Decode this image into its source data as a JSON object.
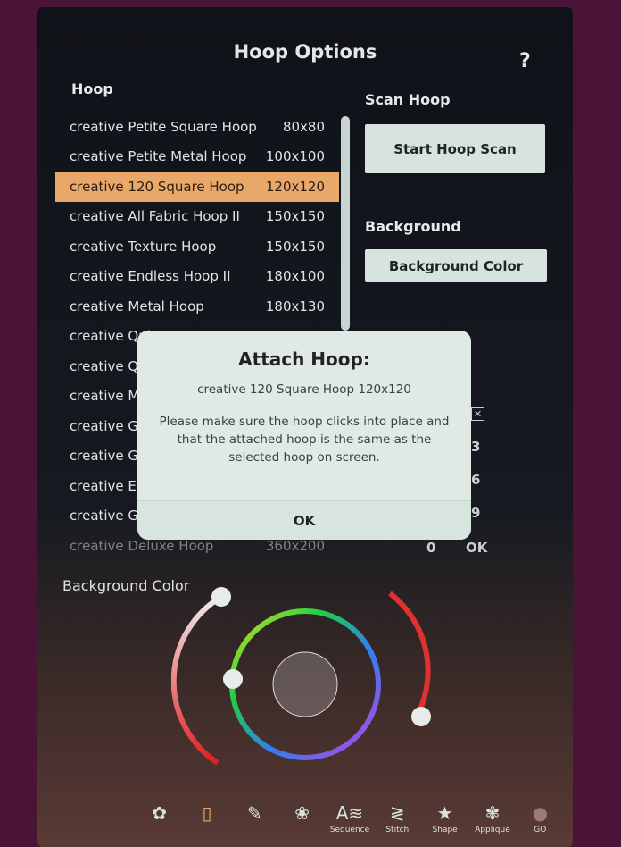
{
  "title": "Hoop Options",
  "help_label": "?",
  "hoop_section": {
    "label": "Hoop",
    "items": [
      {
        "name": "creative Petite Square Hoop",
        "size": "80x80"
      },
      {
        "name": "creative Petite Metal Hoop",
        "size": "100x100"
      },
      {
        "name": "creative 120 Square Hoop",
        "size": "120x120",
        "selected": true
      },
      {
        "name": "creative All Fabric Hoop II",
        "size": "150x150"
      },
      {
        "name": "creative Texture Hoop",
        "size": "150x150"
      },
      {
        "name": "creative Endless Hoop II",
        "size": "180x100"
      },
      {
        "name": "creative Metal Hoop",
        "size": "180x130"
      },
      {
        "name": "creative Qui",
        "size": ""
      },
      {
        "name": "creative Qu",
        "size": ""
      },
      {
        "name": "creative Ma",
        "size": ""
      },
      {
        "name": "creative Gr",
        "size": ""
      },
      {
        "name": "creative Gr",
        "size": ""
      },
      {
        "name": "creative Eli",
        "size": ""
      },
      {
        "name": "creative Gr",
        "size": ""
      },
      {
        "name": "creative Deluxe Hoop",
        "size": "360x200"
      }
    ]
  },
  "scan_hoop": {
    "label": "Scan Hoop",
    "button": "Start Hoop Scan"
  },
  "background": {
    "label": "Background",
    "button": "Background Color"
  },
  "background_color_label": "Background Color",
  "keypad": {
    "k3": "3",
    "k6": "6",
    "k9": "9",
    "k0": "0",
    "ok": "OK",
    "close": "✕"
  },
  "dialog": {
    "title": "Attach Hoop:",
    "hoop": "creative 120 Square Hoop  120x120",
    "message": "Please make sure the hoop clicks into place and that the attached hoop is the same as the selected hoop on screen.",
    "ok": "OK"
  },
  "toolbar": [
    {
      "icon": "embroidery-edit-icon",
      "label": ""
    },
    {
      "icon": "hoop-icon",
      "label": ""
    },
    {
      "icon": "stitch-edit-icon",
      "label": ""
    },
    {
      "icon": "design-icon",
      "label": ""
    },
    {
      "icon": "sequence-icon",
      "label": "Sequence"
    },
    {
      "icon": "stitch-icon",
      "label": "Stitch"
    },
    {
      "icon": "shape-icon",
      "label": "Shape"
    },
    {
      "icon": "applique-icon",
      "label": "Appliqué"
    },
    {
      "icon": "go-icon",
      "label": "GO"
    }
  ],
  "colors": {
    "selected": "#e9a76a",
    "button": "#d7e3de",
    "frame": "#4a1436"
  }
}
